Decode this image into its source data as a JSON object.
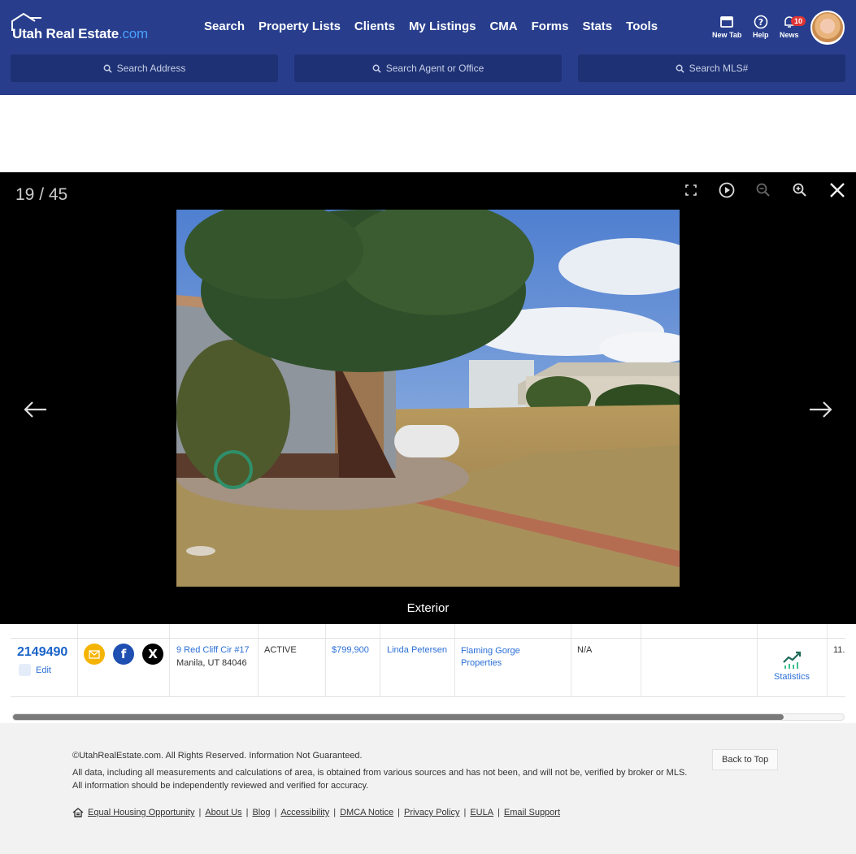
{
  "brand": {
    "name": "Utah Real Estate",
    "suffix": ".com"
  },
  "nav": [
    "Search",
    "Property Lists",
    "Clients",
    "My Listings",
    "CMA",
    "Forms",
    "Stats",
    "Tools"
  ],
  "utilities": {
    "new_tab": "New Tab",
    "help": "Help",
    "news": "News",
    "news_count": "10"
  },
  "search": {
    "address": "Search Address",
    "agent": "Search Agent or Office",
    "mls": "Search MLS#"
  },
  "viewer": {
    "counter": "19 / 45",
    "caption": "Exterior"
  },
  "listing": {
    "mls": "2149490",
    "edit": "Edit",
    "address_line1": "9 Red Cliff Cir #17",
    "address_line2": "Manila, UT 84046",
    "status": "ACTIVE",
    "price": "$799,900",
    "agent": "Linda Petersen",
    "office": "Flaming Gorge Properties",
    "col_na": "N/A",
    "stats_label": "Statistics",
    "truncated": "11."
  },
  "footer": {
    "copyright": "©UtahRealEstate.com. All Rights Reserved. Information Not Guaranteed.",
    "disclaimer": "All data, including all measurements and calculations of area, is obtained from various sources and has not been, and will not be, verified by broker or MLS. All information should be independently reviewed and verified for accuracy.",
    "back_to_top": "Back to Top",
    "links": [
      "Equal Housing Opportunity",
      "About Us",
      "Blog",
      "Accessibility",
      "DMCA Notice",
      "Privacy Policy",
      "EULA",
      "Email Support"
    ]
  },
  "colors": {
    "header": "#283e8d",
    "search_bg": "#1e3175",
    "link": "#2a6fd6",
    "badge": "#e03434"
  },
  "icons": [
    "new-tab-icon",
    "help-icon",
    "bell-icon",
    "search-icon",
    "fullscreen-icon",
    "play-icon",
    "zoom-out-icon",
    "zoom-in-icon",
    "close-icon",
    "arrow-left-icon",
    "arrow-right-icon",
    "email-icon",
    "facebook-icon",
    "x-icon",
    "statistics-icon",
    "equal-housing-icon"
  ]
}
